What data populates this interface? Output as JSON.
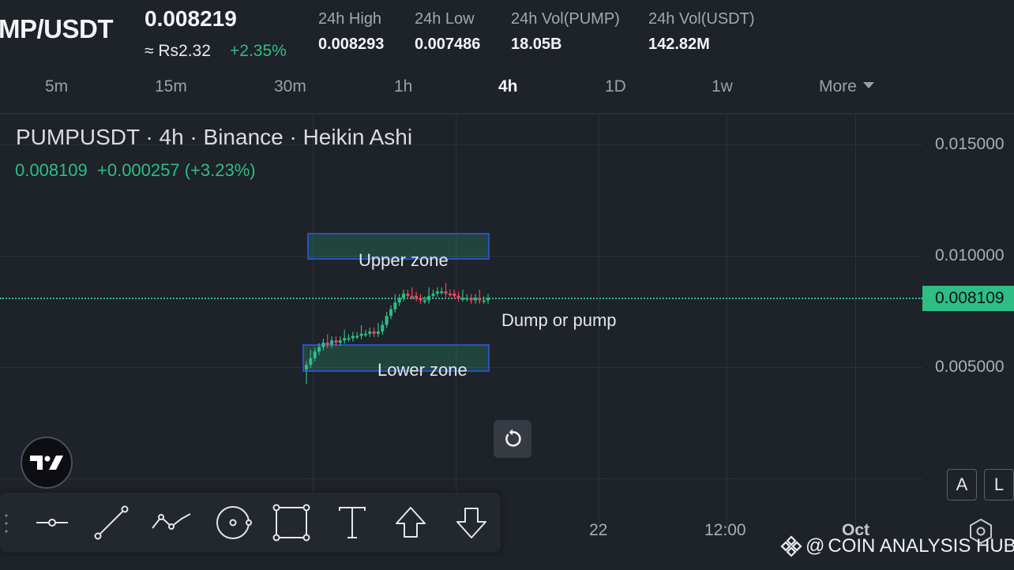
{
  "ticker": {
    "pair": "MP/USDT",
    "last_price": "0.008219",
    "fiat_price": "≈ Rs2.32",
    "change": "+2.35%",
    "stats": [
      {
        "label": "24h High",
        "value": "0.008293"
      },
      {
        "label": "24h Low",
        "value": "0.007486"
      },
      {
        "label": "24h Vol(PUMP)",
        "value": "18.05B"
      },
      {
        "label": "24h Vol(USDT)",
        "value": "142.82M"
      }
    ]
  },
  "intervals": {
    "items": [
      "5m",
      "15m",
      "30m",
      "1h",
      "4h",
      "1D",
      "1w"
    ],
    "active": "4h",
    "more_label": "More"
  },
  "chart": {
    "legend_title": "PUMPUSDT · 4h · Binance · Heikin Ashi",
    "legend_close": "0.008109",
    "legend_change": "+0.000257 (+3.23%)",
    "price_labels": [
      "0.015000",
      "0.010000",
      "0.005000"
    ],
    "current_price_label": "0.008109",
    "time_labels": [
      "22",
      "12:00",
      "Oct"
    ],
    "upper_zone_label": "Upper zone",
    "lower_zone_label": "Lower zone",
    "note": "Dump or pump",
    "colors": {
      "up": "#2ebd85",
      "down": "#f6465d",
      "zone_border": "#2a4fc7"
    }
  },
  "chart_data": {
    "type": "candlestick",
    "title": "PUMPUSDT · 4h · Binance · Heikin Ashi",
    "ylim": [
      0.0025,
      0.0165
    ],
    "yticks": [
      0.015,
      0.01,
      0.005
    ],
    "current_price": 0.008109,
    "zones": [
      {
        "name": "Upper zone",
        "low": 0.0089,
        "high": 0.0101
      },
      {
        "name": "Lower zone",
        "low": 0.0049,
        "high": 0.0061
      }
    ],
    "closes": [
      0.0051,
      0.0054,
      0.0057,
      0.0059,
      0.0061,
      0.006,
      0.0062,
      0.0061,
      0.0062,
      0.0063,
      0.0063,
      0.0064,
      0.0064,
      0.0065,
      0.0065,
      0.0066,
      0.0065,
      0.0066,
      0.0069,
      0.0073,
      0.0076,
      0.0079,
      0.0081,
      0.0083,
      0.0082,
      0.0082,
      0.0081,
      0.008,
      0.008,
      0.0082,
      0.0083,
      0.0084,
      0.0084,
      0.0083,
      0.0083,
      0.0082,
      0.0081,
      0.0081,
      0.0081,
      0.008,
      0.0081,
      0.008,
      0.008,
      0.00811
    ]
  },
  "toolbar": {
    "tools": [
      "horizontal-line-icon",
      "trend-line-icon",
      "path-icon",
      "circle-icon",
      "rectangle-icon",
      "text-icon",
      "arrow-up-icon",
      "arrow-down-icon"
    ]
  },
  "side_buttons": {
    "auto": "A",
    "log": "L"
  },
  "watermark": {
    "at": "@",
    "text": "COIN ANALYSIS HUB"
  }
}
